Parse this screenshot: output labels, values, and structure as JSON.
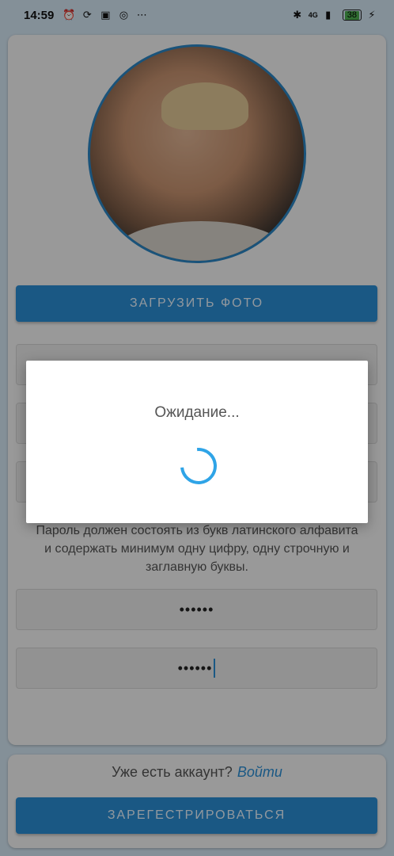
{
  "status_bar": {
    "time": "14:59",
    "network": "4G",
    "battery": "38"
  },
  "form": {
    "upload_label": "ЗАГРУЗИТЬ ФОТО",
    "field1_value": "",
    "field2_value": "",
    "field3_value": "",
    "password_hint": "Пароль должен состоять из букв латинского алфавита и содержать минимум одну цифру, одну строчную и заглавную буквы.",
    "password_value": "••••••",
    "password_confirm_value": "••••••"
  },
  "footer": {
    "have_account_text": "Уже есть аккаунт?",
    "login_link": "Войти",
    "register_label": "ЗАРЕГЕСТРИРОВАТЬСЯ"
  },
  "dialog": {
    "message": "Ожидание..."
  },
  "colors": {
    "accent": "#2b8fd6",
    "spinner": "#2fa4e7",
    "background": "#d6e8f5"
  }
}
